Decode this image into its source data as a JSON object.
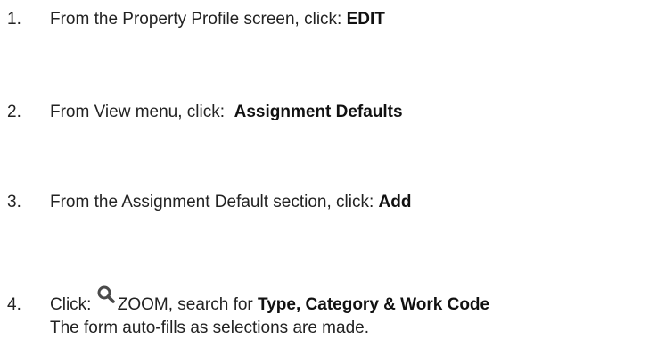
{
  "steps": [
    {
      "number": "1.",
      "text": "From the Property Profile screen, click: ",
      "bold": "EDIT"
    },
    {
      "number": "2.",
      "text": "From View menu, click:  ",
      "bold": "Assignment Defaults"
    },
    {
      "number": "3.",
      "text": "From the Assignment Default section, click: ",
      "bold": "Add"
    },
    {
      "number": "4.",
      "text_before_icon": "Click: ",
      "icon": "search-icon",
      "text_after_icon": "ZOOM, search for ",
      "bold": "Type, Category & Work Code",
      "subtext": "The form auto-fills as selections are made."
    }
  ]
}
